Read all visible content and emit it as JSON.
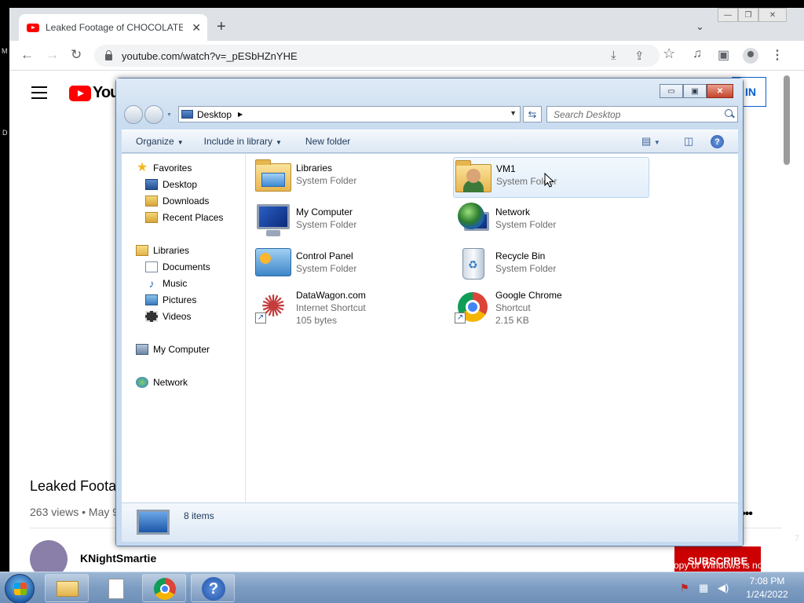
{
  "browser": {
    "tab_title": "Leaked Footage of CHOCOLATE",
    "tab_close": "✕",
    "new_tab": "+",
    "tab_search": "⌄",
    "win_minimize": "—",
    "win_restore": "❐",
    "win_close": "✕",
    "back": "←",
    "forward": "→",
    "reload": "↻",
    "url": "youtube.com/watch?v=_pESbHZnYHE",
    "install_icon": "⤓",
    "share_icon": "⇪",
    "bookmark_icon": "☆",
    "media_icon": "♫",
    "sidepanel_icon": "▣",
    "menu_icon": "⋮"
  },
  "youtube": {
    "logo_text": "YouTube",
    "sign_in": "IN",
    "video_title": "Leaked Foota",
    "video_meta": "263 views • May 9",
    "more_dots": "•••",
    "channel_name": "KNightSmartie",
    "subscribe": "SUBSCRIBE"
  },
  "explorer": {
    "win_minimize": "▭",
    "win_maximize": "▣",
    "win_close": "✕",
    "address": "Desktop",
    "address_arrow": "▶",
    "address_dropdown": "▼",
    "refresh": "⇆",
    "search_placeholder": "Search Desktop",
    "toolbar": {
      "organize": "Organize",
      "include_in_library": "Include in library",
      "new_folder": "New folder",
      "caret": "▼"
    },
    "nav": {
      "favorites": "Favorites",
      "desktop": "Desktop",
      "downloads": "Downloads",
      "recent_places": "Recent Places",
      "libraries": "Libraries",
      "documents": "Documents",
      "music": "Music",
      "pictures": "Pictures",
      "videos": "Videos",
      "my_computer": "My Computer",
      "network": "Network"
    },
    "files": [
      {
        "name": "Libraries",
        "sub1": "System Folder",
        "sub2": ""
      },
      {
        "name": "VM1",
        "sub1": "System Folder",
        "sub2": ""
      },
      {
        "name": "My Computer",
        "sub1": "System Folder",
        "sub2": ""
      },
      {
        "name": "Network",
        "sub1": "System Folder",
        "sub2": ""
      },
      {
        "name": "Control Panel",
        "sub1": "System Folder",
        "sub2": ""
      },
      {
        "name": "Recycle Bin",
        "sub1": "System Folder",
        "sub2": ""
      },
      {
        "name": "DataWagon.com",
        "sub1": "Internet Shortcut",
        "sub2": "105 bytes"
      },
      {
        "name": "Google Chrome",
        "sub1": "Shortcut",
        "sub2": "2.15 KB"
      }
    ],
    "item_count": "8 items"
  },
  "desktop": {
    "edge_m": "M",
    "edge_d": "D",
    "genuine_notice": "This copy of Windows is not genuine",
    "edge_7": "7"
  },
  "taskbar": {
    "help_glyph": "?",
    "time": "7:08 PM",
    "date": "1/24/2022"
  },
  "colors": {
    "youtube_red": "#ff0000",
    "subscribe_red": "#cc0000",
    "explorer_frame": "#c6dcf1",
    "selection": "#e2eefa"
  }
}
